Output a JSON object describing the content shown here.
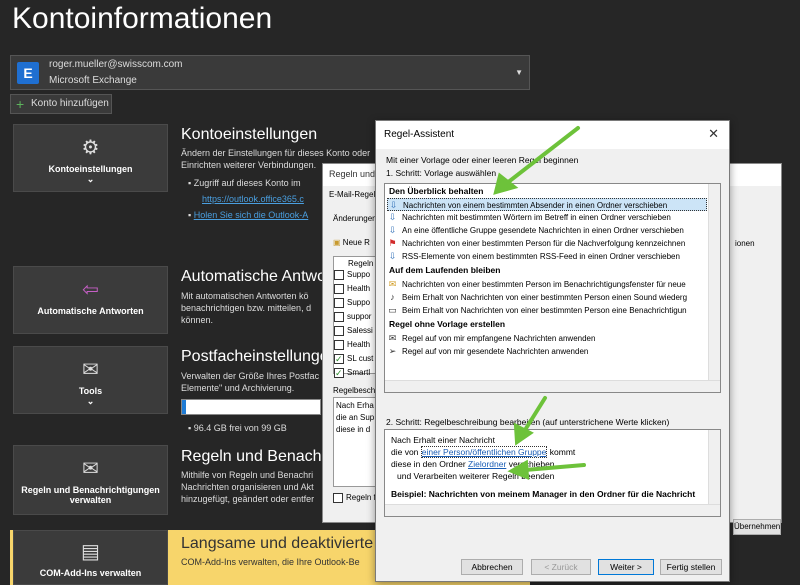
{
  "page": {
    "title": "Kontoinformationen"
  },
  "account": {
    "email": "roger.mueller@swisscom.com",
    "type": "Microsoft Exchange",
    "add_label": "Konto hinzufügen"
  },
  "tiles": {
    "account_settings": "Kontoeinstellungen",
    "auto_replies": "Automatische Antworten",
    "tools": "Tools",
    "rules": "Regeln und Benachrichtigungen verwalten",
    "com_addins": "COM-Add-Ins verwalten"
  },
  "sections": {
    "account_settings": {
      "heading": "Kontoeinstellungen",
      "text": "Ändern der Einstellungen für dieses Konto oder Einrichten weiterer Verbindungen.",
      "bullet1": "Zugriff auf dieses Konto im",
      "link1": "https://outlook.office365.c",
      "link2": "Holen Sie sich die Outlook-A"
    },
    "auto_replies": {
      "heading": "Automatische Antwor",
      "text": "Mit automatischen Antworten kö benachrichtigen bzw. mitteilen, d können."
    },
    "mailbox": {
      "heading": "Postfacheinstellungen",
      "text": "Verwalten der Größe Ihres Postfac Elemente\" und Archivierung.",
      "free": "96.4 GB frei von 99 GB"
    },
    "rules": {
      "heading": "Regeln und Benachri",
      "text": "Mithilfe von Regeln und Benachri Nachrichten organisieren und Akt hinzugefügt, geändert oder entfer"
    },
    "com": {
      "heading": "Langsame und deaktivierte CO",
      "text": "COM-Add-Ins verwalten, die Ihre Outlook-Be"
    }
  },
  "back_dialog": {
    "title": "Regeln und",
    "tab": "E-Mail-Regeln",
    "change_label": "Änderungen",
    "new_rule": "Neue R",
    "col_header": "Regeln",
    "rows": [
      "Suppo",
      "Health",
      "Suppo",
      "suppor",
      "Salessi",
      "Health",
      "SL cust",
      "Smartl"
    ],
    "desc_label": "Regelbesch",
    "desc_lines": [
      "Nach Erha",
      "die an Sup",
      "diese in d"
    ],
    "rules_footer": "Regeln f",
    "apply_btn": "Übernehmen",
    "right_label": "ionen"
  },
  "wizard": {
    "title": "Regel-Assistent",
    "intro": "Mit einer Vorlage oder einer leeren Regel beginnen",
    "step1": "1. Schritt: Vorlage auswählen",
    "group1": "Den Überblick behalten",
    "items1": [
      "Nachrichten von einem bestimmten Absender in einen Ordner verschieben",
      "Nachrichten mit bestimmten Wörtern im Betreff in einen Ordner verschieben",
      "An eine öffentliche Gruppe gesendete Nachrichten in einen Ordner verschieben",
      "Nachrichten von einer bestimmten Person für die Nachverfolgung kennzeichnen",
      "RSS-Elemente von einem bestimmten RSS-Feed in einen Ordner verschieben"
    ],
    "group2": "Auf dem Laufenden bleiben",
    "items2": [
      "Nachrichten von einer bestimmten Person im Benachrichtigungsfenster für neue",
      "Beim Erhalt von Nachrichten von einer bestimmten Person einen Sound wiederg",
      "Beim Erhalt von Nachrichten von einer bestimmten Person eine Benachrichtigun"
    ],
    "group3": "Regel ohne Vorlage erstellen",
    "items3": [
      "Regel auf von mir empfangene Nachrichten anwenden",
      "Regel auf von mir gesendete Nachrichten anwenden"
    ],
    "step2": "2. Schritt: Regelbeschreibung bearbeiten (auf unterstrichene Werte klicken)",
    "desc_line1": "Nach Erhalt einer Nachricht",
    "desc_line2_pre": "die von",
    "desc_line2_link": "einer Person/öffentlichen Gruppe",
    "desc_line2_post": "kommt",
    "desc_line3_pre": "diese in den Ordner",
    "desc_line3_link": "Zielordner",
    "desc_line3_post": "verschieben",
    "desc_line4": "und Verarbeiten weiterer Regeln beenden",
    "example": "Beispiel: Nachrichten von meinem Manager in den Ordner für die Nachricht",
    "buttons": {
      "cancel": "Abbrechen",
      "back": "< Zurück",
      "next": "Weiter >",
      "finish": "Fertig stellen"
    }
  },
  "colors": {
    "background": "#262626",
    "tile": "#3b3b3b",
    "accent": "#6dc23a",
    "selection": "#cce4f7"
  }
}
